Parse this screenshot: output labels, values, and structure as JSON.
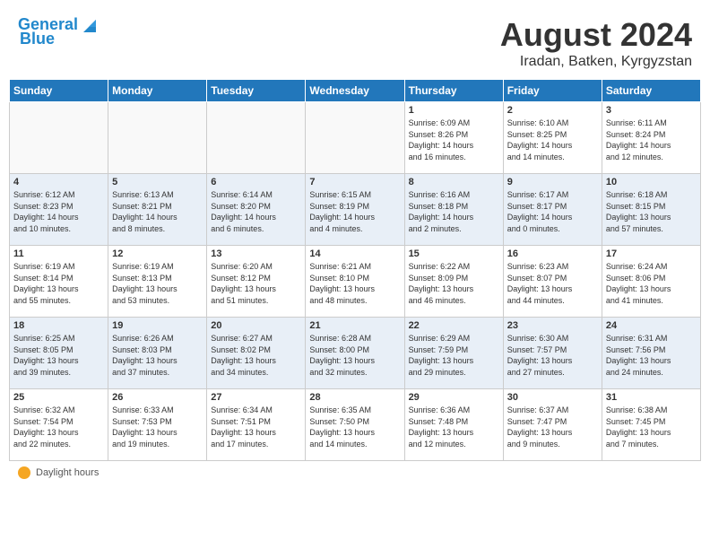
{
  "header": {
    "logo_line1": "General",
    "logo_line2": "Blue",
    "title": "August 2024",
    "subtitle": "Iradan, Batken, Kyrgyzstan"
  },
  "days_of_week": [
    "Sunday",
    "Monday",
    "Tuesday",
    "Wednesday",
    "Thursday",
    "Friday",
    "Saturday"
  ],
  "weeks": [
    [
      {
        "day": "",
        "info": ""
      },
      {
        "day": "",
        "info": ""
      },
      {
        "day": "",
        "info": ""
      },
      {
        "day": "",
        "info": ""
      },
      {
        "day": "1",
        "info": "Sunrise: 6:09 AM\nSunset: 8:26 PM\nDaylight: 14 hours\nand 16 minutes."
      },
      {
        "day": "2",
        "info": "Sunrise: 6:10 AM\nSunset: 8:25 PM\nDaylight: 14 hours\nand 14 minutes."
      },
      {
        "day": "3",
        "info": "Sunrise: 6:11 AM\nSunset: 8:24 PM\nDaylight: 14 hours\nand 12 minutes."
      }
    ],
    [
      {
        "day": "4",
        "info": "Sunrise: 6:12 AM\nSunset: 8:23 PM\nDaylight: 14 hours\nand 10 minutes."
      },
      {
        "day": "5",
        "info": "Sunrise: 6:13 AM\nSunset: 8:21 PM\nDaylight: 14 hours\nand 8 minutes."
      },
      {
        "day": "6",
        "info": "Sunrise: 6:14 AM\nSunset: 8:20 PM\nDaylight: 14 hours\nand 6 minutes."
      },
      {
        "day": "7",
        "info": "Sunrise: 6:15 AM\nSunset: 8:19 PM\nDaylight: 14 hours\nand 4 minutes."
      },
      {
        "day": "8",
        "info": "Sunrise: 6:16 AM\nSunset: 8:18 PM\nDaylight: 14 hours\nand 2 minutes."
      },
      {
        "day": "9",
        "info": "Sunrise: 6:17 AM\nSunset: 8:17 PM\nDaylight: 14 hours\nand 0 minutes."
      },
      {
        "day": "10",
        "info": "Sunrise: 6:18 AM\nSunset: 8:15 PM\nDaylight: 13 hours\nand 57 minutes."
      }
    ],
    [
      {
        "day": "11",
        "info": "Sunrise: 6:19 AM\nSunset: 8:14 PM\nDaylight: 13 hours\nand 55 minutes."
      },
      {
        "day": "12",
        "info": "Sunrise: 6:19 AM\nSunset: 8:13 PM\nDaylight: 13 hours\nand 53 minutes."
      },
      {
        "day": "13",
        "info": "Sunrise: 6:20 AM\nSunset: 8:12 PM\nDaylight: 13 hours\nand 51 minutes."
      },
      {
        "day": "14",
        "info": "Sunrise: 6:21 AM\nSunset: 8:10 PM\nDaylight: 13 hours\nand 48 minutes."
      },
      {
        "day": "15",
        "info": "Sunrise: 6:22 AM\nSunset: 8:09 PM\nDaylight: 13 hours\nand 46 minutes."
      },
      {
        "day": "16",
        "info": "Sunrise: 6:23 AM\nSunset: 8:07 PM\nDaylight: 13 hours\nand 44 minutes."
      },
      {
        "day": "17",
        "info": "Sunrise: 6:24 AM\nSunset: 8:06 PM\nDaylight: 13 hours\nand 41 minutes."
      }
    ],
    [
      {
        "day": "18",
        "info": "Sunrise: 6:25 AM\nSunset: 8:05 PM\nDaylight: 13 hours\nand 39 minutes."
      },
      {
        "day": "19",
        "info": "Sunrise: 6:26 AM\nSunset: 8:03 PM\nDaylight: 13 hours\nand 37 minutes."
      },
      {
        "day": "20",
        "info": "Sunrise: 6:27 AM\nSunset: 8:02 PM\nDaylight: 13 hours\nand 34 minutes."
      },
      {
        "day": "21",
        "info": "Sunrise: 6:28 AM\nSunset: 8:00 PM\nDaylight: 13 hours\nand 32 minutes."
      },
      {
        "day": "22",
        "info": "Sunrise: 6:29 AM\nSunset: 7:59 PM\nDaylight: 13 hours\nand 29 minutes."
      },
      {
        "day": "23",
        "info": "Sunrise: 6:30 AM\nSunset: 7:57 PM\nDaylight: 13 hours\nand 27 minutes."
      },
      {
        "day": "24",
        "info": "Sunrise: 6:31 AM\nSunset: 7:56 PM\nDaylight: 13 hours\nand 24 minutes."
      }
    ],
    [
      {
        "day": "25",
        "info": "Sunrise: 6:32 AM\nSunset: 7:54 PM\nDaylight: 13 hours\nand 22 minutes."
      },
      {
        "day": "26",
        "info": "Sunrise: 6:33 AM\nSunset: 7:53 PM\nDaylight: 13 hours\nand 19 minutes."
      },
      {
        "day": "27",
        "info": "Sunrise: 6:34 AM\nSunset: 7:51 PM\nDaylight: 13 hours\nand 17 minutes."
      },
      {
        "day": "28",
        "info": "Sunrise: 6:35 AM\nSunset: 7:50 PM\nDaylight: 13 hours\nand 14 minutes."
      },
      {
        "day": "29",
        "info": "Sunrise: 6:36 AM\nSunset: 7:48 PM\nDaylight: 13 hours\nand 12 minutes."
      },
      {
        "day": "30",
        "info": "Sunrise: 6:37 AM\nSunset: 7:47 PM\nDaylight: 13 hours\nand 9 minutes."
      },
      {
        "day": "31",
        "info": "Sunrise: 6:38 AM\nSunset: 7:45 PM\nDaylight: 13 hours\nand 7 minutes."
      }
    ]
  ],
  "footer": {
    "daylight_label": "Daylight hours"
  },
  "colors": {
    "header_bg": "#2277bb",
    "alt_row": "#e8eff7"
  }
}
